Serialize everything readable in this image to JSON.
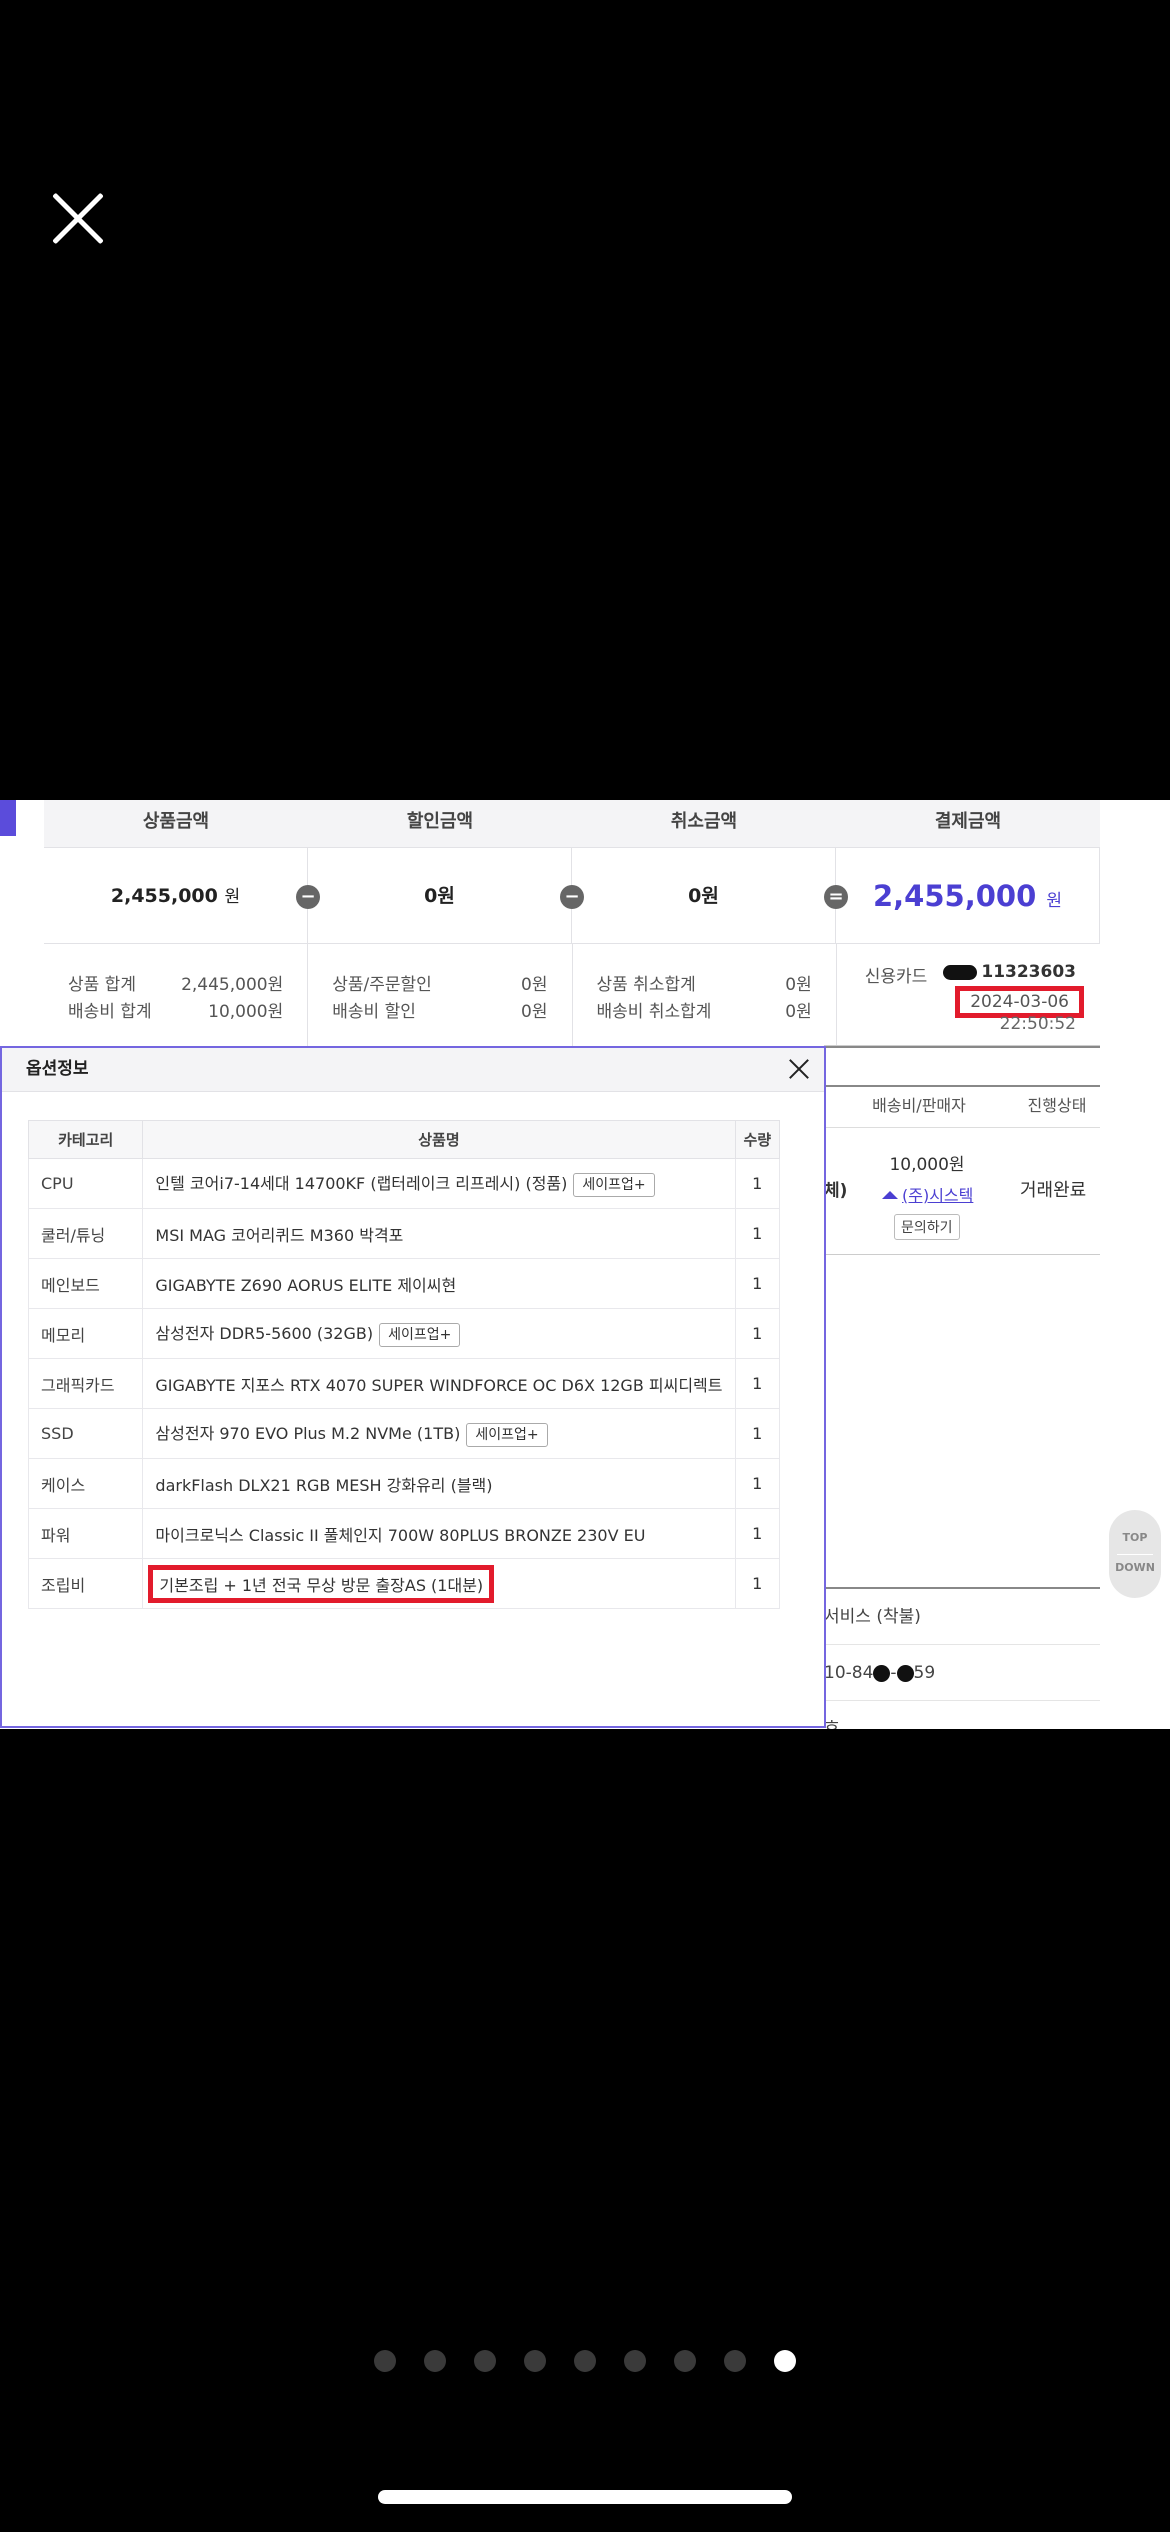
{
  "summary": {
    "headers": [
      "상품금액",
      "할인금액",
      "취소금액",
      "결제금액"
    ],
    "product_amount": "2,455,000",
    "won": "원",
    "discount_amount": "0원",
    "cancel_amount": "0원",
    "payment_amount": "2,455,000",
    "ops": [
      "−",
      "−",
      "="
    ],
    "details": {
      "product_total_label": "상품 합계",
      "product_total": "2,445,000원",
      "shipping_total_label": "배송비 합계",
      "shipping_total": "10,000원",
      "order_discount_label": "상품/주문할인",
      "order_discount": "0원",
      "shipping_discount_label": "배송비 할인",
      "shipping_discount": "0원",
      "cancel_total_label": "상품 취소합계",
      "cancel_total": "0원",
      "shipping_cancel_label": "배송비 취소합계",
      "shipping_cancel": "0원"
    },
    "payment": {
      "method": "신용카드",
      "card_number": "11323603",
      "date": "2024-03-06",
      "time": "22:50:52"
    }
  },
  "background": {
    "col_shipping_seller": "배송비/판매자",
    "col_status": "진행상태",
    "paren": "체)",
    "shipping_fee": "10,000원",
    "seller": "(주)시스텍",
    "ask_button": "문의하기",
    "status": "거래완료",
    "row1": "서비스 (착불)",
    "row2_a": "10-84",
    "row2_b": "59",
    "row3": "호"
  },
  "modal": {
    "title": "옵션정보",
    "columns": [
      "카테고리",
      "상품명",
      "수량"
    ],
    "rows": [
      {
        "category": "CPU",
        "name": "인텔 코어i7-14세대 14700KF (랩터레이크 리프레시) (정품)",
        "tag": "세이프업+",
        "qty": "1"
      },
      {
        "category": "쿨러/튜닝",
        "name": "MSI MAG 코어리퀴드 M360 박격포",
        "tag": "",
        "qty": "1"
      },
      {
        "category": "메인보드",
        "name": "GIGABYTE Z690 AORUS ELITE 제이씨현",
        "tag": "",
        "qty": "1"
      },
      {
        "category": "메모리",
        "name": "삼성전자 DDR5-5600 (32GB)",
        "tag": "세이프업+",
        "qty": "1"
      },
      {
        "category": "그래픽카드",
        "name": "GIGABYTE 지포스 RTX 4070 SUPER WINDFORCE OC D6X 12GB 피씨디렉트",
        "tag": "",
        "qty": "1"
      },
      {
        "category": "SSD",
        "name": "삼성전자 970 EVO Plus M.2 NVMe (1TB)",
        "tag": "세이프업+",
        "qty": "1"
      },
      {
        "category": "케이스",
        "name": "darkFlash DLX21 RGB MESH 강화유리 (블랙)",
        "tag": "",
        "qty": "1"
      },
      {
        "category": "파워",
        "name": "마이크로닉스 Classic II 풀체인지 700W 80PLUS BRONZE 230V EU",
        "tag": "",
        "qty": "1"
      },
      {
        "category": "조립비",
        "name": "기본조립 + 1년 전국 무상 방문 출장AS (1대분)",
        "tag": "",
        "qty": "1",
        "highlight": true
      }
    ]
  },
  "scroll": {
    "top": "TOP",
    "down": "DOWN"
  },
  "pager": {
    "count": 9,
    "active_index": 8
  },
  "colors": {
    "accent": "#4b3fd2",
    "highlight_box": "#e21b2c",
    "modal_border": "#7466e0"
  }
}
